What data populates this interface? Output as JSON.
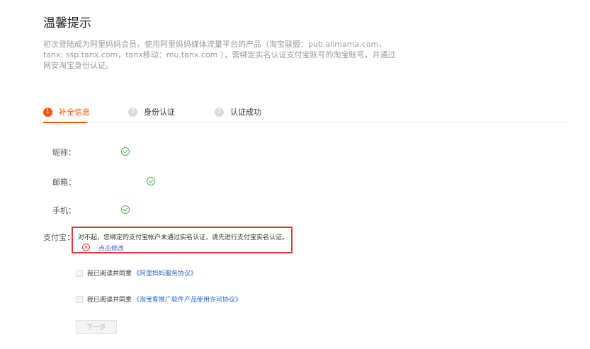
{
  "header": {
    "title": "温馨提示",
    "desc": "初次登陆成为阿里妈妈会员，使用阿里妈妈媒体流量平台的产品（淘宝联盟：pub.alimama.com， tanx: ssp.tanx.com，tanx移动：mu.tanx.com ），需绑定实名认证支付宝账号的淘宝账号，并通过网安淘宝身份认证。"
  },
  "steps": [
    {
      "num": "1",
      "label": "补全信息",
      "active": true
    },
    {
      "num": "2",
      "label": "身份认证",
      "active": false
    },
    {
      "num": "3",
      "label": "认证成功",
      "active": false
    }
  ],
  "form": {
    "nickname_label": "昵称：",
    "email_label": "邮箱：",
    "phone_label": "手机：",
    "alipay_label": "支付宝：",
    "alipay_error": "对不起，您绑定的支付宝帐户未通过实名认证，请先进行支付宝实名认证。",
    "alipay_fix_link": "点击修改",
    "error_icon": "x-circle-icon",
    "check_icon": "check-circle-icon"
  },
  "agreements": [
    {
      "prefix": "我已阅读并同意",
      "link": "《阿里妈妈服务协议》"
    },
    {
      "prefix": "我已阅读并同意",
      "link": "《淘宝客推广软件产品使用许可协议》"
    }
  ],
  "buttons": {
    "next": "下一步"
  },
  "colors": {
    "accent": "#ff5000",
    "link": "#2a64c8",
    "error": "#e53935",
    "success": "#4caf50"
  }
}
